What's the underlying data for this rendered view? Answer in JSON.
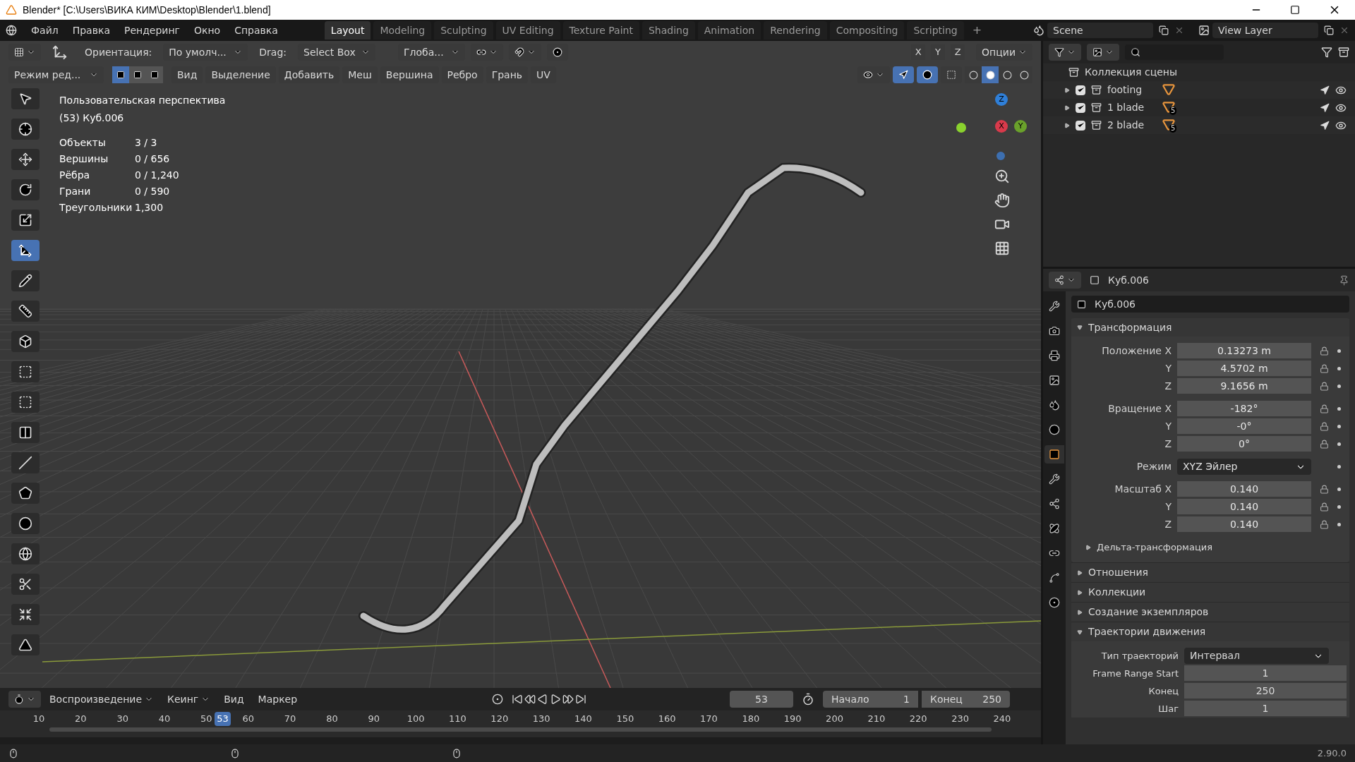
{
  "window": {
    "title": "Blender* [C:\\Users\\ВИКА КИМ\\Desktop\\Blender\\1.blend]"
  },
  "menu": [
    "Файл",
    "Правка",
    "Рендеринг",
    "Окно",
    "Справка"
  ],
  "workspace_tabs": [
    {
      "label": "Layout",
      "selected": true
    },
    {
      "label": "Modeling",
      "selected": false
    },
    {
      "label": "Sculpting",
      "selected": false
    },
    {
      "label": "UV Editing",
      "selected": false
    },
    {
      "label": "Texture Paint",
      "selected": false
    },
    {
      "label": "Shading",
      "selected": false
    },
    {
      "label": "Animation",
      "selected": false
    },
    {
      "label": "Rendering",
      "selected": false
    },
    {
      "label": "Compositing",
      "selected": false
    },
    {
      "label": "Scripting",
      "selected": false
    }
  ],
  "add_tab": "+",
  "scene": "Scene",
  "view_layer": "View Layer",
  "viewport_header": {
    "orientation_label": "Ориентация:",
    "orientation": "По умолч...",
    "drag_label": "Drag:",
    "drag": "Select Box",
    "transform": "Глоба...",
    "axes": [
      "X",
      "Y",
      "Z"
    ],
    "options": "Опции"
  },
  "edit_header": {
    "mode": "Режим ред...",
    "select_modes": [
      {
        "selected": true
      },
      {
        "selected": false
      },
      {
        "selected": false
      }
    ],
    "menus": [
      "Вид",
      "Выделение",
      "Добавить",
      "Меш",
      "Вершина",
      "Ребро",
      "Грань",
      "UV"
    ],
    "shading_modes": [
      {
        "selected": false
      },
      {
        "selected": true
      },
      {
        "selected": false
      },
      {
        "selected": false
      }
    ]
  },
  "overlay": {
    "view_name": "Пользовательская перспектива",
    "object_name": "(53) Куб.006",
    "stats": [
      {
        "label": "Объекты",
        "value": "3 / 3"
      },
      {
        "label": "Вершины",
        "value": "0 / 656"
      },
      {
        "label": "Рёбра",
        "value": "0 / 1,240"
      },
      {
        "label": "Грани",
        "value": "0 / 590"
      },
      {
        "label": "Треугольники",
        "value": "1,300"
      }
    ]
  },
  "toolbar": [
    {
      "selected": false
    },
    {
      "selected": false
    },
    {
      "selected": false
    },
    {
      "selected": false
    },
    {
      "selected": false
    },
    {
      "selected": true
    },
    {
      "selected": false
    },
    {
      "selected": false
    },
    {
      "selected": false
    },
    {
      "selected": false
    },
    {
      "selected": false
    },
    {
      "selected": false
    },
    {
      "selected": false
    },
    {
      "selected": false
    },
    {
      "selected": false
    },
    {
      "selected": false
    },
    {
      "selected": false
    },
    {
      "selected": false
    },
    {
      "selected": false
    }
  ],
  "gizmo": {
    "z": "Z",
    "y": "Y",
    "x": "X"
  },
  "outliner": {
    "root": "Коллекция сцены",
    "items": [
      {
        "name": "footing",
        "checked": true
      },
      {
        "name": "1 blade",
        "checked": true,
        "badge": "5"
      },
      {
        "name": "2 blade",
        "checked": true,
        "badge": "5"
      }
    ]
  },
  "properties": {
    "header": "Куб.006",
    "name": "Куб.006",
    "tabs": [
      {
        "selected": false
      },
      {
        "selected": false
      },
      {
        "selected": false
      },
      {
        "selected": false
      },
      {
        "selected": false
      },
      {
        "selected": false
      },
      {
        "selected": true
      },
      {
        "selected": false
      },
      {
        "selected": false
      },
      {
        "selected": false
      },
      {
        "selected": false
      },
      {
        "selected": false
      },
      {
        "selected": false
      }
    ],
    "transform": {
      "title": "Трансформация",
      "expanded": true,
      "groups": [
        [
          {
            "kind": "number",
            "label": "Положение X",
            "value": "0.13273 m"
          },
          {
            "kind": "number",
            "label": "Y",
            "value": "4.5702 m"
          },
          {
            "kind": "number",
            "label": "Z",
            "value": "9.1656 m"
          }
        ],
        [
          {
            "kind": "number",
            "label": "Вращение X",
            "value": "-182°"
          },
          {
            "kind": "number",
            "label": "Y",
            "value": "-0°"
          },
          {
            "kind": "number",
            "label": "Z",
            "value": "0°"
          }
        ],
        [
          {
            "kind": "dropdown",
            "label": "Режим",
            "value": "XYZ Эйлер"
          }
        ],
        [
          {
            "kind": "number",
            "label": "Масштаб X",
            "value": "0.140"
          },
          {
            "kind": "number",
            "label": "Y",
            "value": "0.140"
          },
          {
            "kind": "number",
            "label": "Z",
            "value": "0.140"
          }
        ]
      ],
      "subpanel": "Дельта-трансформация"
    },
    "panels": [
      {
        "title": "Отношения",
        "expanded": false
      },
      {
        "title": "Коллекции",
        "expanded": false
      },
      {
        "title": "Создание экземпляров",
        "expanded": false
      },
      {
        "title": "Траектории движения",
        "expanded": true
      }
    ],
    "motion_paths": [
      {
        "kind": "dropdown",
        "label": "Тип траекторий",
        "value": "Интервал"
      },
      {
        "kind": "number",
        "label": "Frame Range Start",
        "value": "1"
      },
      {
        "kind": "number",
        "label": "Конец",
        "value": "250"
      },
      {
        "kind": "number",
        "label": "Шаг",
        "value": "1"
      }
    ]
  },
  "timeline": {
    "menus": [
      "Воспроизведение",
      "Кеинг",
      "Вид",
      "Маркер"
    ],
    "current_frame": "53",
    "start_label": "Начало",
    "start": "1",
    "end_label": "Конец",
    "end": "250",
    "ticks": [
      "10",
      "20",
      "30",
      "40",
      "50",
      "60",
      "70",
      "80",
      "90",
      "100",
      "110",
      "120",
      "130",
      "140",
      "150",
      "160",
      "170",
      "180",
      "190",
      "200",
      "210",
      "220",
      "230",
      "240"
    ],
    "playhead": "53"
  },
  "status_bar": {
    "version": "2.90.0"
  }
}
